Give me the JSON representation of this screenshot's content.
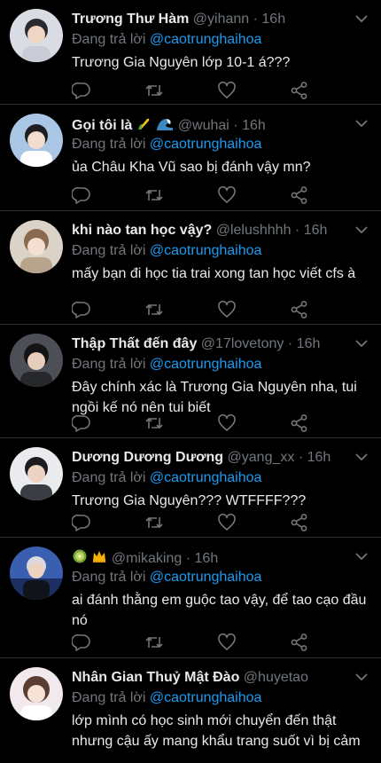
{
  "tweets": [
    {
      "name": "Trương Thư Hàm",
      "handle": "@yihann",
      "time": "16h",
      "reply_prefix": "Đang trả lời",
      "reply_to": "@caotrunghaihoa",
      "text": "Trương Gia Nguyên lớp 10-1 á???"
    },
    {
      "name": "Gọi tôi là",
      "name_emojis": [
        "corn-emoji",
        "wave-emoji"
      ],
      "handle": "@wuhai",
      "time": "16h",
      "reply_prefix": "Đang trả lời",
      "reply_to": "@caotrunghaihoa",
      "text": "ủa Châu Kha Vũ sao bị đánh vậy mn?"
    },
    {
      "name": "khi nào tan học vậy?",
      "handle": "@lelushhhh",
      "time": "16h",
      "reply_prefix": "Đang trả lời",
      "reply_to": "@caotrunghaihoa",
      "text": "mấy bạn đi học tia trai xong tan học viết cfs à"
    },
    {
      "name": "Thập Thất đến đây",
      "handle": "@17lovetony",
      "time": "16h",
      "reply_prefix": "Đang trả lời",
      "reply_to": "@caotrunghaihoa",
      "text": "Đây chính xác là Trương Gia Nguyên nha, tui ngồi kế nó nên tui biết"
    },
    {
      "name": "Dương Dương Dương",
      "handle": "@yang_xx",
      "time": "16h",
      "reply_prefix": "Đang trả lời",
      "reply_to": "@caotrunghaihoa",
      "text": "Trương Gia Nguyên??? WTFFFF???"
    },
    {
      "name": "",
      "name_emojis": [
        "kiwi-emoji",
        "crown-emoji"
      ],
      "handle": "@mikaking",
      "time": "16h",
      "reply_prefix": "Đang trả lời",
      "reply_to": "@caotrunghaihoa",
      "text": "ai đánh thằng em guộc tao vậy, để tao cạo đầu nó"
    },
    {
      "name": "Nhân Gian Thuỷ Mật Đào",
      "handle": "@huyetao",
      "time": "",
      "reply_prefix": "Đang trả lời",
      "reply_to": "@caotrunghaihoa",
      "text": "lớp mình có học sinh mới chuyển đến thật nhưng cậu ấy mang khẩu trang suốt vì bị cảm"
    }
  ],
  "separator": "·",
  "colors": {
    "background": "#000000",
    "text": "#e7e9ea",
    "muted": "#71767b",
    "link": "#1d9bf0",
    "divider": "#2f3336"
  },
  "icons": {
    "reply": "reply-icon",
    "retweet": "retweet-icon",
    "like": "heart-icon",
    "share": "share-icon",
    "more": "chevron-down-icon"
  }
}
